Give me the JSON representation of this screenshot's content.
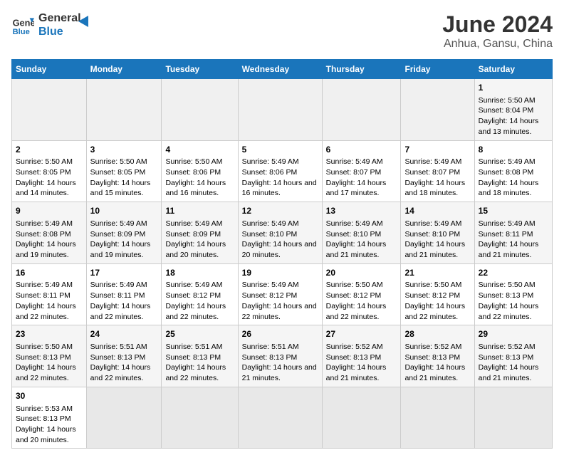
{
  "header": {
    "logo_general": "General",
    "logo_blue": "Blue",
    "title": "June 2024",
    "subtitle": "Anhua, Gansu, China"
  },
  "days_of_week": [
    "Sunday",
    "Monday",
    "Tuesday",
    "Wednesday",
    "Thursday",
    "Friday",
    "Saturday"
  ],
  "weeks": [
    [
      {
        "day": null,
        "sunrise": null,
        "sunset": null,
        "daylight": null
      },
      {
        "day": null,
        "sunrise": null,
        "sunset": null,
        "daylight": null
      },
      {
        "day": null,
        "sunrise": null,
        "sunset": null,
        "daylight": null
      },
      {
        "day": null,
        "sunrise": null,
        "sunset": null,
        "daylight": null
      },
      {
        "day": null,
        "sunrise": null,
        "sunset": null,
        "daylight": null
      },
      {
        "day": null,
        "sunrise": null,
        "sunset": null,
        "daylight": null
      },
      {
        "day": "1",
        "sunrise": "5:50 AM",
        "sunset": "8:04 PM",
        "daylight": "14 hours and 13 minutes."
      }
    ],
    [
      {
        "day": "2",
        "sunrise": "5:50 AM",
        "sunset": "8:05 PM",
        "daylight": "14 hours and 14 minutes."
      },
      {
        "day": "3",
        "sunrise": "5:50 AM",
        "sunset": "8:05 PM",
        "daylight": "14 hours and 15 minutes."
      },
      {
        "day": "4",
        "sunrise": "5:50 AM",
        "sunset": "8:06 PM",
        "daylight": "14 hours and 16 minutes."
      },
      {
        "day": "5",
        "sunrise": "5:49 AM",
        "sunset": "8:06 PM",
        "daylight": "14 hours and 16 minutes."
      },
      {
        "day": "6",
        "sunrise": "5:49 AM",
        "sunset": "8:07 PM",
        "daylight": "14 hours and 17 minutes."
      },
      {
        "day": "7",
        "sunrise": "5:49 AM",
        "sunset": "8:07 PM",
        "daylight": "14 hours and 18 minutes."
      },
      {
        "day": "8",
        "sunrise": "5:49 AM",
        "sunset": "8:08 PM",
        "daylight": "14 hours and 18 minutes."
      }
    ],
    [
      {
        "day": "9",
        "sunrise": "5:49 AM",
        "sunset": "8:08 PM",
        "daylight": "14 hours and 19 minutes."
      },
      {
        "day": "10",
        "sunrise": "5:49 AM",
        "sunset": "8:09 PM",
        "daylight": "14 hours and 19 minutes."
      },
      {
        "day": "11",
        "sunrise": "5:49 AM",
        "sunset": "8:09 PM",
        "daylight": "14 hours and 20 minutes."
      },
      {
        "day": "12",
        "sunrise": "5:49 AM",
        "sunset": "8:10 PM",
        "daylight": "14 hours and 20 minutes."
      },
      {
        "day": "13",
        "sunrise": "5:49 AM",
        "sunset": "8:10 PM",
        "daylight": "14 hours and 21 minutes."
      },
      {
        "day": "14",
        "sunrise": "5:49 AM",
        "sunset": "8:10 PM",
        "daylight": "14 hours and 21 minutes."
      },
      {
        "day": "15",
        "sunrise": "5:49 AM",
        "sunset": "8:11 PM",
        "daylight": "14 hours and 21 minutes."
      }
    ],
    [
      {
        "day": "16",
        "sunrise": "5:49 AM",
        "sunset": "8:11 PM",
        "daylight": "14 hours and 22 minutes."
      },
      {
        "day": "17",
        "sunrise": "5:49 AM",
        "sunset": "8:11 PM",
        "daylight": "14 hours and 22 minutes."
      },
      {
        "day": "18",
        "sunrise": "5:49 AM",
        "sunset": "8:12 PM",
        "daylight": "14 hours and 22 minutes."
      },
      {
        "day": "19",
        "sunrise": "5:49 AM",
        "sunset": "8:12 PM",
        "daylight": "14 hours and 22 minutes."
      },
      {
        "day": "20",
        "sunrise": "5:50 AM",
        "sunset": "8:12 PM",
        "daylight": "14 hours and 22 minutes."
      },
      {
        "day": "21",
        "sunrise": "5:50 AM",
        "sunset": "8:12 PM",
        "daylight": "14 hours and 22 minutes."
      },
      {
        "day": "22",
        "sunrise": "5:50 AM",
        "sunset": "8:13 PM",
        "daylight": "14 hours and 22 minutes."
      }
    ],
    [
      {
        "day": "23",
        "sunrise": "5:50 AM",
        "sunset": "8:13 PM",
        "daylight": "14 hours and 22 minutes."
      },
      {
        "day": "24",
        "sunrise": "5:51 AM",
        "sunset": "8:13 PM",
        "daylight": "14 hours and 22 minutes."
      },
      {
        "day": "25",
        "sunrise": "5:51 AM",
        "sunset": "8:13 PM",
        "daylight": "14 hours and 22 minutes."
      },
      {
        "day": "26",
        "sunrise": "5:51 AM",
        "sunset": "8:13 PM",
        "daylight": "14 hours and 21 minutes."
      },
      {
        "day": "27",
        "sunrise": "5:52 AM",
        "sunset": "8:13 PM",
        "daylight": "14 hours and 21 minutes."
      },
      {
        "day": "28",
        "sunrise": "5:52 AM",
        "sunset": "8:13 PM",
        "daylight": "14 hours and 21 minutes."
      },
      {
        "day": "29",
        "sunrise": "5:52 AM",
        "sunset": "8:13 PM",
        "daylight": "14 hours and 21 minutes."
      }
    ],
    [
      {
        "day": "30",
        "sunrise": "5:53 AM",
        "sunset": "8:13 PM",
        "daylight": "14 hours and 20 minutes."
      },
      {
        "day": null,
        "sunrise": null,
        "sunset": null,
        "daylight": null
      },
      {
        "day": null,
        "sunrise": null,
        "sunset": null,
        "daylight": null
      },
      {
        "day": null,
        "sunrise": null,
        "sunset": null,
        "daylight": null
      },
      {
        "day": null,
        "sunrise": null,
        "sunset": null,
        "daylight": null
      },
      {
        "day": null,
        "sunrise": null,
        "sunset": null,
        "daylight": null
      },
      {
        "day": null,
        "sunrise": null,
        "sunset": null,
        "daylight": null
      }
    ]
  ],
  "labels": {
    "sunrise": "Sunrise:",
    "sunset": "Sunset:",
    "daylight": "Daylight:"
  }
}
